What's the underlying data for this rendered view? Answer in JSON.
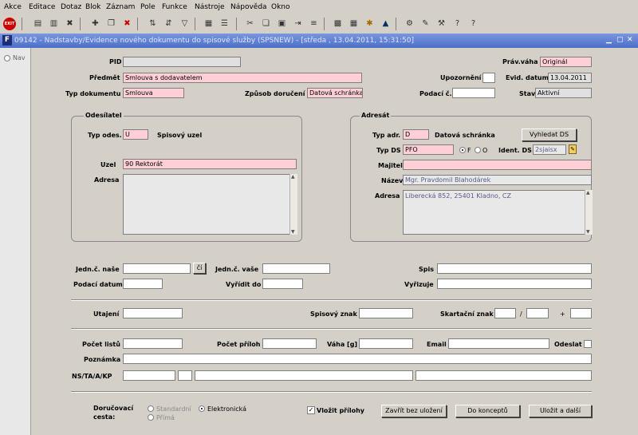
{
  "menu": [
    "Akce",
    "Editace",
    "Dotaz",
    "Blok",
    "Záznam",
    "Pole",
    "Funkce",
    "Nástroje",
    "Nápověda",
    "Okno"
  ],
  "window_title": "09142 - Nadstavby/Evidence nového dokumentu do spisové služby (SPSNEW) - [středa , 13.04.2011, 15:31:50]",
  "nav_label": "Nav",
  "header": {
    "pid_label": "PID",
    "pid_value": "",
    "predmet_label": "Předmět",
    "predmet_value": "Smlouva s dodavatelem",
    "typ_dok_label": "Typ dokumentu",
    "typ_dok_value": "Smlouva",
    "zpusob_label": "Způsob doručení",
    "zpusob_value": "Datová schránka",
    "prav_vaha_label": "Práv.váha",
    "prav_vaha_value": "Originál",
    "upozorneni_label": "Upozornění",
    "upozorneni_value": "",
    "evid_datum_label": "Evid. datum",
    "evid_datum_value": "13.04.2011",
    "podaci_label": "Podací č.",
    "podaci_value": "",
    "stav_label": "Stav",
    "stav_value": "Aktivní"
  },
  "odesilatel": {
    "title": "Odesílatel",
    "typ_label": "Typ odes.",
    "typ_value": "U",
    "typ_desc": "Spisový uzel",
    "uzel_label": "Uzel",
    "uzel_value": "90 Rektorát",
    "adresa_label": "Adresa",
    "adresa_value": ""
  },
  "adresat": {
    "title": "Adresát",
    "typ_label": "Typ adr.",
    "typ_value": "D",
    "typ_desc": "Datová schránka",
    "vyhledat_label": "Vyhledat DS",
    "typ_ds_label": "Typ DS",
    "typ_ds_value": "PFO",
    "radio_f": "F",
    "radio_o": "O",
    "ident_label": "Ident. DS",
    "ident_value": "2sjaisx",
    "majitel_label": "Majitel",
    "majitel_value": "",
    "nazev_label": "Název",
    "nazev_value": "Mgr. Pravdomil Blahodárek",
    "adresa_label": "Adresa",
    "adresa_value": "Liberecká 852, 25401 Kladno, CZ"
  },
  "mid": {
    "jedn_nase_label": "Jedn.č. naše",
    "ci_label": "čí",
    "jedn_vase_label": "Jedn.č. vaše",
    "spis_label": "Spis",
    "podaci_datum_label": "Podací datum",
    "vyridit_label": "Vyřídit do",
    "vyrizuje_label": "Vyřizuje"
  },
  "row3": {
    "utajeni_label": "Utajení",
    "spisovy_label": "Spisový znak",
    "skartacni_label": "Skartační znak",
    "slash": "/",
    "plus": "+"
  },
  "row4": {
    "pocet_listu_label": "Počet listů",
    "pocet_priloh_label": "Počet příloh",
    "vaha_label": "Váha [g]",
    "email_label": "Email",
    "odeslat_label": "Odeslat",
    "poznamka_label": "Poznámka",
    "ns_label": "NS/TA/A/KP"
  },
  "bottom": {
    "cesta_label1": "Doručovací",
    "cesta_label2": "cesta:",
    "standardni": "Standardní",
    "elektronicka": "Elektronická",
    "prima": "Přímá",
    "vlozit_label": "Vložit přílohy",
    "zavrit_label": "Zavřít bez uložení",
    "do_konceptu_label": "Do konceptů",
    "ulozit_label": "Uložit a další"
  },
  "colors": {
    "required": "#ffcfd6",
    "title_bar": "#4b6fc8"
  }
}
